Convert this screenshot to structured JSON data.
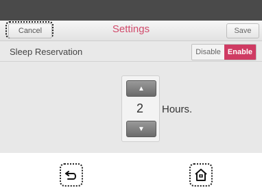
{
  "header": {
    "cancel_label": "Cancel",
    "title": "Settings",
    "save_label": "Save"
  },
  "sleep_reservation": {
    "label": "Sleep Reservation",
    "options": [
      "Disable",
      "Enable"
    ],
    "selected": "Enable"
  },
  "hours_stepper": {
    "value": "2",
    "unit_label": "Hours."
  },
  "icons": {
    "back": "back-arrow-icon",
    "home": "home-icon",
    "up": "triangle-up-icon",
    "down": "triangle-down-icon"
  },
  "colors": {
    "title": "#d14a6b",
    "enable_active": "#cf3b63",
    "top_bar": "#4a4a4a",
    "panel": "#e8e8e8"
  }
}
